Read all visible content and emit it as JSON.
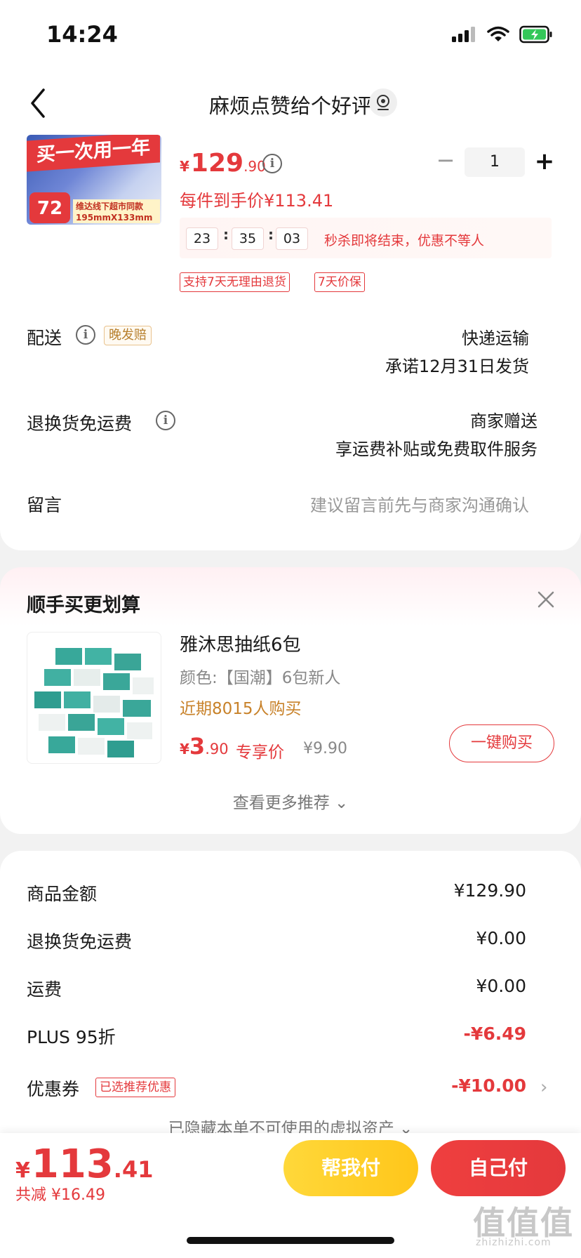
{
  "status_bar": {
    "time": "14:24"
  },
  "header": {
    "title": "麻烦点赞给个好评"
  },
  "product": {
    "thumb_banner": "买一次用一年",
    "thumb_count": "72",
    "thumb_sub1": "维达线下超市同款",
    "thumb_sub2": "195mmX133mm",
    "price_symbol": "¥",
    "price_int": "129",
    "price_dec": ".90",
    "per_item_price": "每件到手价¥113.41",
    "quantity": "1",
    "countdown": {
      "h": "23",
      "m": "35",
      "s": "03",
      "sep": ":",
      "text": "秒杀即将结束，优惠不等人"
    },
    "tags": [
      "支持7天无理由退货",
      "7天价保"
    ]
  },
  "delivery": {
    "label": "配送",
    "late_badge": "晚发赔",
    "method": "快递运输",
    "promise": "承诺12月31日发货"
  },
  "returns": {
    "label": "退换货免运费",
    "value_line1": "商家赠送",
    "value_line2": "享运费补贴或免费取件服务"
  },
  "message": {
    "label": "留言",
    "placeholder": "建议留言前先与商家沟通确认"
  },
  "recommend": {
    "title": "顺手买更划算",
    "item": {
      "name": "雅沐思抽纸6包",
      "spec": "颜色:【国潮】6包新人",
      "sold": "近期8015人购买",
      "price_symbol": "¥",
      "price_int": "3",
      "price_dec": ".90",
      "price_tag": "专享价",
      "original_price": "¥9.90",
      "buy_button": "一键购买"
    },
    "more": "查看更多推荐 ⌄"
  },
  "summary": {
    "rows": [
      {
        "label": "商品金额",
        "value": "¥129.90"
      },
      {
        "label": "退换货免运费",
        "value": "¥0.00"
      },
      {
        "label": "运费",
        "value": "¥0.00"
      },
      {
        "label": "PLUS 95折",
        "value": "-¥6.49"
      },
      {
        "label": "优惠券",
        "value": "-¥10.00"
      }
    ],
    "coupon_tag": "已选推荐优惠",
    "hidden_assets": "已隐藏本单不可使用的虚拟资产 ⌄"
  },
  "bottom_bar": {
    "total_symbol": "¥",
    "total_int": "113",
    "total_dec": ".41",
    "saved": "共减 ¥16.49",
    "help_pay": "帮我付",
    "self_pay": "自己付"
  },
  "watermark": {
    "main": "值值值",
    "sub": "zhizhizhi.com"
  },
  "colors": {
    "accent": "#e4393c",
    "gold": "#ffc61a",
    "badge_gold": "#b7802e"
  }
}
